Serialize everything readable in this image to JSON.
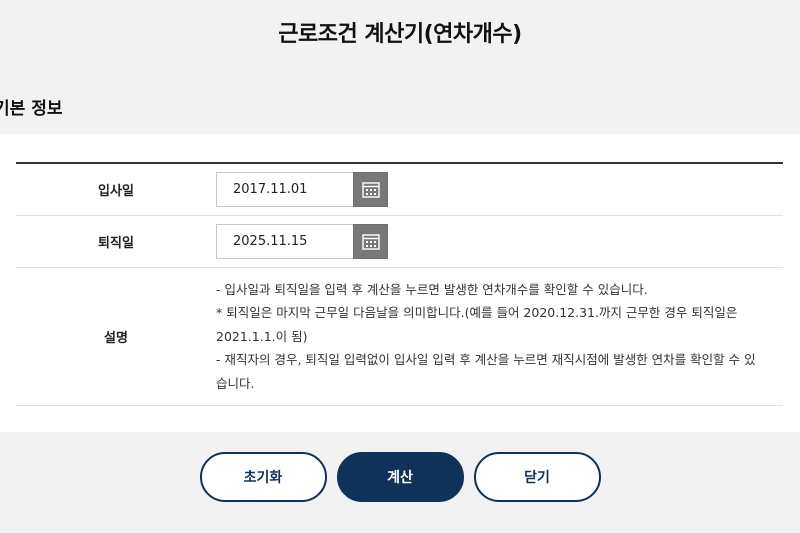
{
  "page": {
    "title": "근로조건 계산기(연차개수)",
    "section_title": "기본 정보"
  },
  "form": {
    "join_date": {
      "label": "입사일",
      "value": "2017.11.01"
    },
    "leave_date": {
      "label": "퇴직일",
      "value": "2025.11.15"
    },
    "description": {
      "label": "설명",
      "lines": [
        "- 입사일과 퇴직일을 입력 후 계산을 누르면 발생한 연차개수를 확인할 수 있습니다.",
        "* 퇴직일은 마지막 근무일 다음날을 의미합니다.(예를 들어 2020.12.31.까지 근무한 경우 퇴직일은 2021.1.1.이 됨)",
        "- 재직자의 경우, 퇴직일 입력없이 입사일 입력 후 계산을 누르면 재직시점에 발생한 연차를 확인할 수 있습니다."
      ]
    }
  },
  "buttons": {
    "reset": "초기화",
    "calculate": "계산",
    "close": "닫기"
  },
  "icons": {
    "calendar": "calendar-icon"
  },
  "colors": {
    "primary": "#0e3259",
    "calendar_button": "#777777",
    "background": "#f2f2f2"
  }
}
